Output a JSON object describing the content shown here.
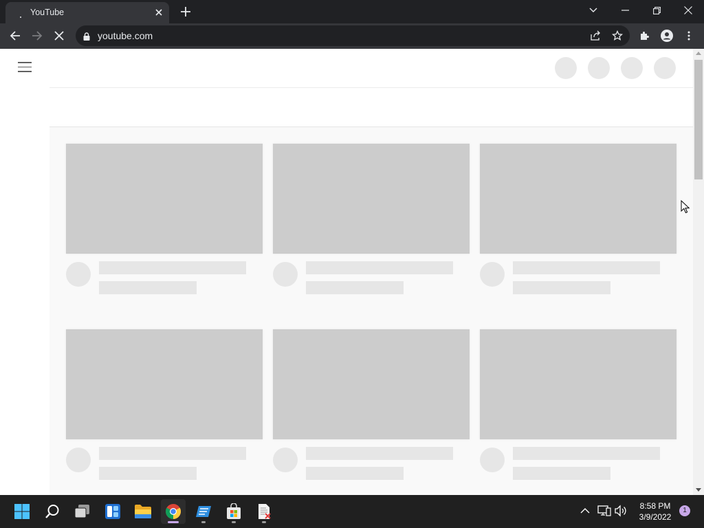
{
  "browser": {
    "tab_title": "YouTube",
    "url": "youtube.com"
  },
  "icons": {
    "tab_close": "close-icon",
    "new_tab": "plus-icon",
    "back": "arrow-left-icon",
    "forward": "arrow-right-icon",
    "stop": "close-icon",
    "lock": "lock-icon",
    "share": "share-icon",
    "bookmark": "star-icon",
    "extensions": "puzzle-icon",
    "profile": "person-icon",
    "menu": "kebab-icon"
  },
  "page": {
    "state": "loading-skeleton",
    "skeleton_cards": 6
  },
  "taskbar": {
    "time": "8:58 PM",
    "date": "3/9/2022",
    "notification_count": "1",
    "apps": [
      "Start",
      "Search",
      "Task View",
      "Widgets",
      "File Explorer",
      "Google Chrome",
      "Notepad",
      "Microsoft Store",
      "Document"
    ]
  },
  "colors": {
    "chrome_dark": "#202124",
    "chrome_toolbar": "#35363a",
    "skeleton_thumb": "#cccccc",
    "skeleton_text": "#e6e6e6",
    "feed_bg": "#f9f9f9",
    "taskbar_bg": "#202020"
  }
}
